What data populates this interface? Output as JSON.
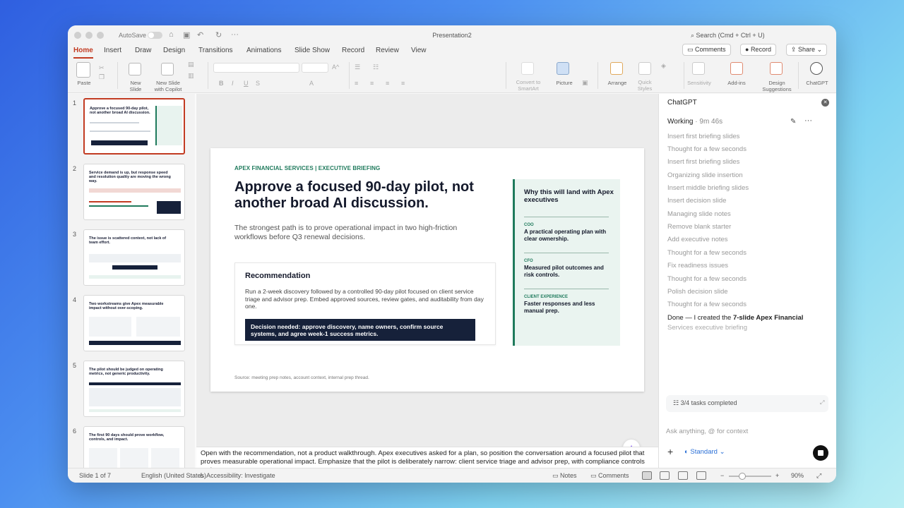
{
  "titlebar": {
    "autosave": "AutoSave",
    "doc_title": "Presentation2",
    "search": "Search (Cmd + Ctrl + U)"
  },
  "tabs": [
    "Home",
    "Insert",
    "Draw",
    "Design",
    "Transitions",
    "Animations",
    "Slide Show",
    "Record",
    "Review",
    "View"
  ],
  "actions": {
    "comments": "Comments",
    "record": "Record",
    "share": "Share"
  },
  "ribbon": {
    "paste": "Paste",
    "new_slide": "New Slide",
    "new_slide_copilot": "New Slide with Copilot",
    "convert": "Convert to SmartArt",
    "picture": "Picture",
    "arrange": "Arrange",
    "quick_styles": "Quick Styles",
    "sensitivity": "Sensitivity",
    "addins": "Add-ins",
    "design_suggestions": "Design Suggestions",
    "chatgpt": "ChatGPT"
  },
  "thumbnails": [
    {
      "num": "1",
      "title": "Approve a focused 90-day pilot, not another broad AI discussion."
    },
    {
      "num": "2",
      "title": "Service demand is up, but response speed and resolution quality are moving the wrong way."
    },
    {
      "num": "3",
      "title": "The issue is scattered context, not lack of team effort."
    },
    {
      "num": "4",
      "title": "Two workstreams give Apex measurable impact without over-scoping."
    },
    {
      "num": "5",
      "title": "The pilot should be judged on operating metrics, not generic productivity."
    },
    {
      "num": "6",
      "title": "The first 90 days should prove workflow, controls, and impact."
    }
  ],
  "slide": {
    "kicker": "APEX FINANCIAL SERVICES | EXECUTIVE BRIEFING",
    "headline": "Approve a focused 90-day pilot, not another broad AI discussion.",
    "subhead": "The strongest path is to prove operational impact in two high-friction workflows before Q3 renewal decisions.",
    "reco_title": "Recommendation",
    "reco_body": "Run a 2-week discovery followed by a controlled 90-day pilot focused on client service triage and advisor prep. Embed approved sources, review gates, and auditability from day one.",
    "decision": "Decision needed: approve discovery, name owners, confirm source systems, and agree week-1 success metrics.",
    "side_title": "Why this will land with Apex executives",
    "side_items": [
      {
        "role": "COO",
        "text": "A practical operating plan with clear ownership."
      },
      {
        "role": "CFO",
        "text": "Measured pilot outcomes and risk controls."
      },
      {
        "role": "CLIENT EXPERIENCE",
        "text": "Faster responses and less manual prep."
      }
    ],
    "source": "Source: meeting prep notes, account context, internal prep thread."
  },
  "notes": "Open with the recommendation, not a product walkthrough. Apex executives asked for a plan, so position the conversation around a focused pilot that proves measurable operational impact. Emphasize that the pilot is deliberately narrow: client service triage and advisor prep, with compliance controls and",
  "panel": {
    "title": "ChatGPT",
    "status": "Working",
    "elapsed": "· 9m 46s",
    "steps": [
      "Insert first briefing slides",
      "Thought for a few seconds",
      "Insert first briefing slides",
      "Organizing slide insertion",
      "Insert middle briefing slides",
      "Insert decision slide",
      "Managing slide notes",
      "Remove blank starter",
      "Add executive notes",
      "Thought for a few seconds",
      "Fix readiness issues",
      "Thought for a few seconds",
      "Polish decision slide",
      "Thought for a few seconds"
    ],
    "done_prefix": "Done — I created the ",
    "done_bold": "7-slide Apex Financial",
    "done_fade": "Services executive briefing",
    "tasks": "3/4 tasks completed",
    "ask_placeholder": "Ask anything, @ for context",
    "mode": "Standard"
  },
  "status": {
    "slide": "Slide 1 of 7",
    "language": "English (United States)",
    "accessibility": "Accessibility: Investigate",
    "notes": "Notes",
    "comments": "Comments",
    "zoom": "90%"
  }
}
